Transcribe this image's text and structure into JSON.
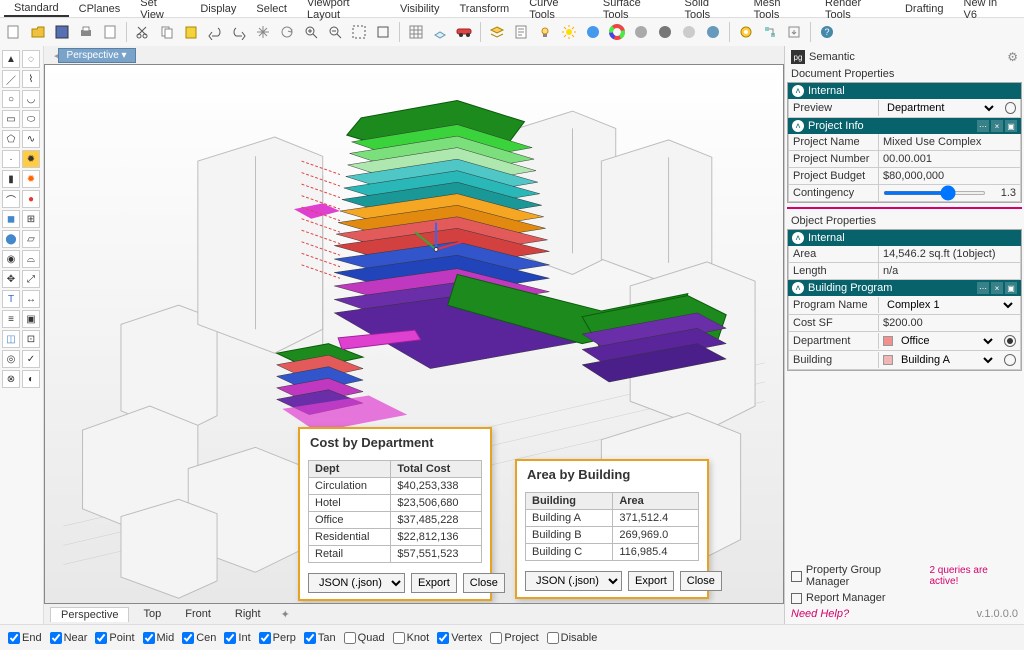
{
  "topbar": {
    "tabs": [
      "Standard",
      "CPlanes",
      "Set View",
      "Display",
      "Select",
      "Viewport Layout",
      "Visibility",
      "Transform",
      "Curve Tools",
      "Surface Tools",
      "Solid Tools",
      "Mesh Tools",
      "Render Tools",
      "Drafting",
      "New in V6"
    ],
    "active": 0
  },
  "viewport": {
    "tab": "Perspective",
    "footer_tabs": [
      "Perspective",
      "Top",
      "Front",
      "Right"
    ],
    "footer_active": 0
  },
  "floatboxes": [
    {
      "title": "Cost by Department",
      "columns": [
        "Dept",
        "Total Cost"
      ],
      "rows": [
        [
          "Circulation",
          "$40,253,338"
        ],
        [
          "Hotel",
          "$23,506,680"
        ],
        [
          "Office",
          "$37,485,228"
        ],
        [
          "Residential",
          "$22,812,136"
        ],
        [
          "Retail",
          "$57,551,523"
        ]
      ],
      "format": "JSON (.json)",
      "buttons": [
        "Export",
        "Close"
      ]
    },
    {
      "title": "Area by Building",
      "columns": [
        "Building",
        "Area"
      ],
      "rows": [
        [
          "Building A",
          "371,512.4"
        ],
        [
          "Building B",
          "269,969.0"
        ],
        [
          "Building C",
          "116,985.4"
        ]
      ],
      "format": "JSON (.json)",
      "buttons": [
        "Export",
        "Close"
      ]
    }
  ],
  "right": {
    "panel_title": "Semantic",
    "doc_props_label": "Document Properties",
    "obj_props_label": "Object Properties",
    "sections": {
      "internal": {
        "title": "Internal",
        "preview_label": "Preview",
        "preview_value": "Department"
      },
      "project": {
        "title": "Project Info",
        "rows": [
          [
            "Project Name",
            "Mixed Use Complex"
          ],
          [
            "Project Number",
            "00.00.001"
          ],
          [
            "Project Budget",
            "$80,000,000"
          ]
        ],
        "contingency_label": "Contingency",
        "contingency_value": "1.3"
      },
      "internal2": {
        "title": "Internal",
        "rows": [
          [
            "Area",
            "14,546.2 sq.ft (1object)"
          ],
          [
            "Length",
            "n/a"
          ]
        ]
      },
      "program": {
        "title": "Building Program",
        "program_name_label": "Program Name",
        "program_name_value": "Complex 1",
        "cost_sf_label": "Cost SF",
        "cost_sf_value": "$200.00",
        "department_label": "Department",
        "department_value": "Office",
        "building_label": "Building",
        "building_value": "Building A"
      }
    },
    "pgm_label": "Property Group Manager",
    "rm_label": "Report Manager",
    "queries": "2 queries are active!",
    "help": "Need Help?",
    "version": "v.1.0.0.0"
  },
  "osnap": {
    "items": [
      [
        "End",
        true
      ],
      [
        "Near",
        true
      ],
      [
        "Point",
        true
      ],
      [
        "Mid",
        true
      ],
      [
        "Cen",
        true
      ],
      [
        "Int",
        true
      ],
      [
        "Perp",
        true
      ],
      [
        "Tan",
        true
      ],
      [
        "Quad",
        false
      ],
      [
        "Knot",
        false
      ],
      [
        "Vertex",
        true
      ],
      [
        "Project",
        false
      ],
      [
        "Disable",
        false
      ]
    ]
  }
}
